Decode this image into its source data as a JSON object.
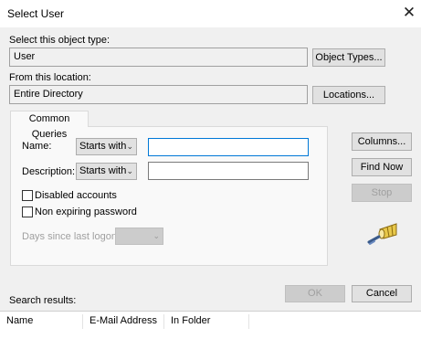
{
  "window": {
    "title": "Select User"
  },
  "object_type": {
    "label": "Select this object type:",
    "value": "User",
    "button": "Object Types..."
  },
  "location": {
    "label": "From this location:",
    "value": "Entire Directory",
    "button": "Locations..."
  },
  "tab": {
    "label": "Common Queries"
  },
  "name_row": {
    "label": "Name:",
    "operator": "Starts with",
    "value": ""
  },
  "description_row": {
    "label": "Description:",
    "operator": "Starts with",
    "value": ""
  },
  "checkboxes": {
    "disabled_accounts": {
      "label": "Disabled accounts",
      "checked": false
    },
    "non_expiring_password": {
      "label": "Non expiring password",
      "checked": false
    }
  },
  "days_logon": {
    "label": "Days since last logon:",
    "value": ""
  },
  "side_buttons": {
    "columns": "Columns...",
    "find_now": "Find Now",
    "stop": "Stop"
  },
  "footer": {
    "ok": "OK",
    "cancel": "Cancel"
  },
  "results": {
    "label": "Search results:",
    "columns": [
      "Name",
      "E-Mail Address",
      "In Folder"
    ]
  },
  "icons": {
    "close": "close-icon",
    "search": "search-flashlight-icon",
    "dropdown": "chevron-down-icon"
  }
}
